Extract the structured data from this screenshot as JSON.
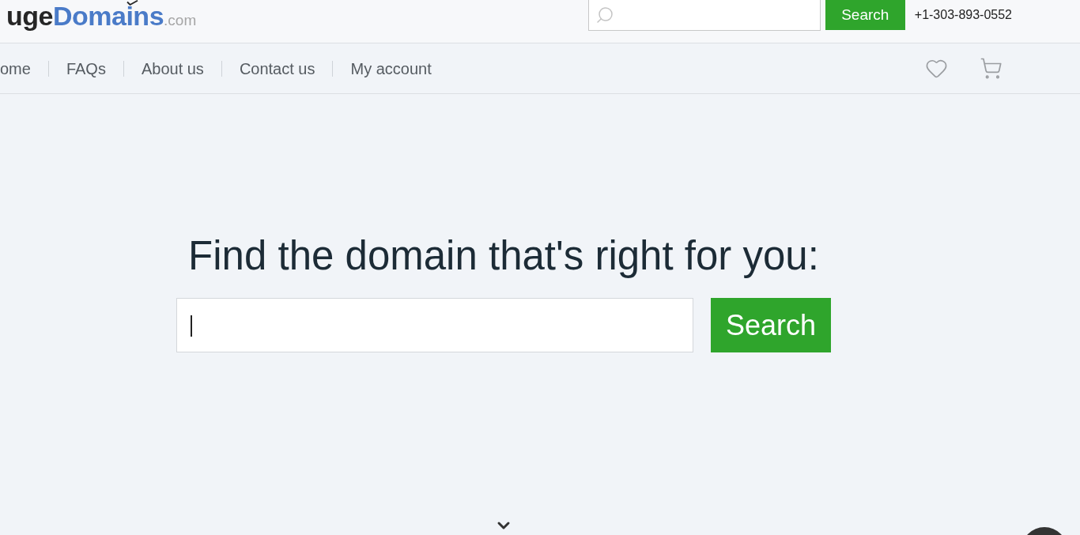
{
  "header": {
    "logo": {
      "part_1": "uge",
      "part_2": "Domains",
      "suffix": ".com"
    },
    "search_button": "Search",
    "phone": "+1-303-893-0552"
  },
  "nav": {
    "items": [
      "ome",
      "FAQs",
      "About us",
      "Contact us",
      "My account"
    ]
  },
  "hero": {
    "title": "Find the domain that's right for you:",
    "search_focused": true,
    "search_button": "Search"
  }
}
